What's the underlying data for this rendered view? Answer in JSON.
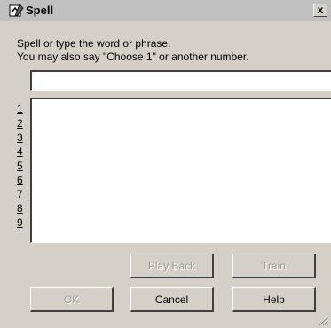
{
  "window": {
    "title": "Spell",
    "close_label": "x"
  },
  "instructions": {
    "line1": "Spell or type the word or phrase.",
    "line2": "You may also say \"Choose 1\" or another number."
  },
  "input": {
    "value": ""
  },
  "choices": [
    "1",
    "2",
    "3",
    "4",
    "5",
    "6",
    "7",
    "8",
    "9"
  ],
  "buttons": {
    "play_back": "Play Back",
    "train": "Train",
    "ok": "OK",
    "cancel": "Cancel",
    "help": "Help"
  },
  "icons": {
    "app": "spell-app-icon",
    "close": "close-icon",
    "resize": "resize-grip-icon"
  }
}
